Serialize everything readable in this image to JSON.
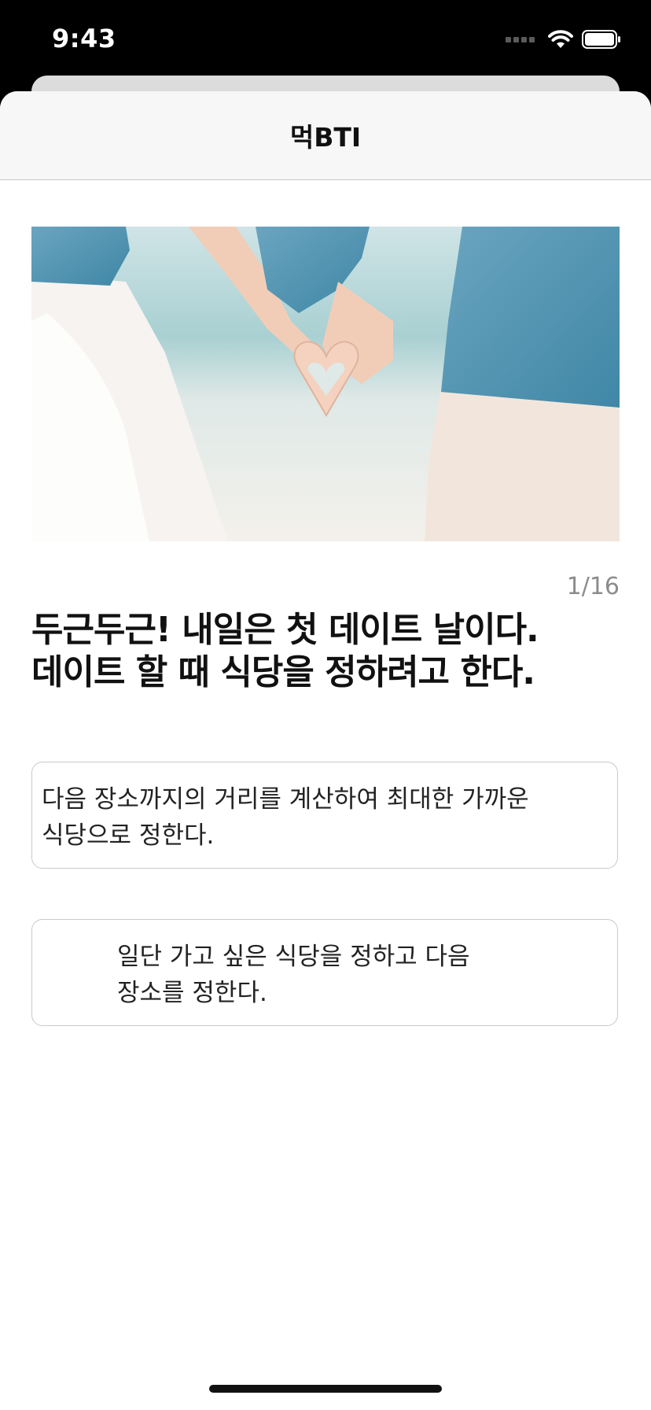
{
  "status_bar": {
    "time": "9:43",
    "icons": [
      "signal-icon",
      "wifi-icon",
      "battery-icon"
    ]
  },
  "nav": {
    "title": "먹BTI"
  },
  "hero": {
    "description_icon": "couple-heart-hands-photo"
  },
  "progress": {
    "text": "1/16",
    "current": 1,
    "total": 16
  },
  "question": {
    "line1": "두근두근! 내일은 첫 데이트 날이다.",
    "line2": "데이트 할 때 식당을 정하려고 한다."
  },
  "answers": [
    {
      "line1": "다음 장소까지의 거리를 계산하여 최대한 가까운",
      "line2": "식당으로 정한다."
    },
    {
      "line1": "일단 가고 싶은 식당을 정하고 다음",
      "line2": "장소를 정한다."
    }
  ],
  "colors": {
    "background": "#ffffff",
    "nav_bar": "#f7f7f7",
    "border": "#c9c9c9",
    "muted_text": "#8c8c8c"
  }
}
